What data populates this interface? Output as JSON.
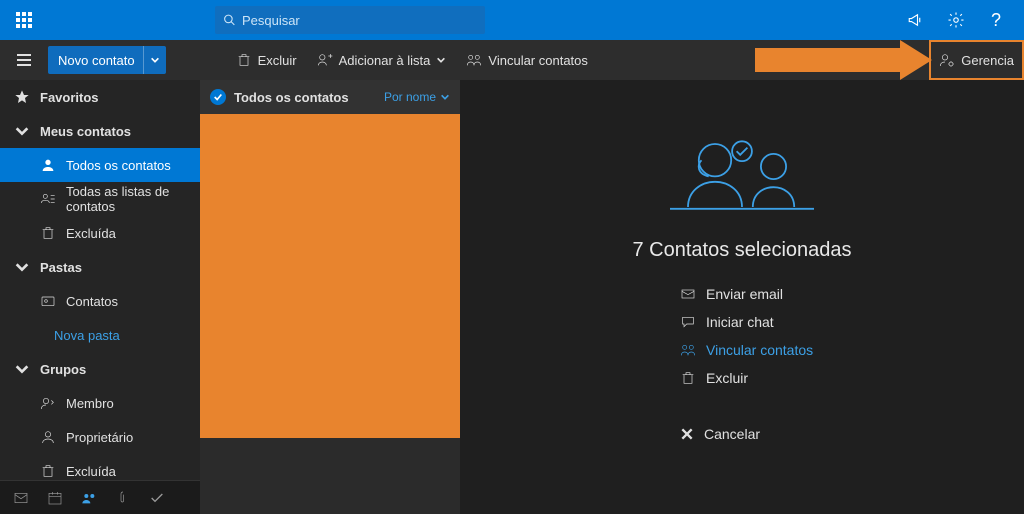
{
  "search": {
    "placeholder": "Pesquisar"
  },
  "toolbar": {
    "new_contact": "Novo contato",
    "delete": "Excluir",
    "add_to_list": "Adicionar à lista",
    "link_contacts": "Vincular contatos",
    "manage": "Gerencia"
  },
  "sidebar": {
    "favorites": "Favoritos",
    "my_contacts": "Meus contatos",
    "all_contacts": "Todos os contatos",
    "all_lists": "Todas as listas de contatos",
    "deleted": "Excluída",
    "folders": "Pastas",
    "contacts_folder": "Contatos",
    "new_folder": "Nova pasta",
    "groups": "Grupos",
    "member": "Membro",
    "owner": "Proprietário",
    "deleted2": "Excluída"
  },
  "list": {
    "title": "Todos os contatos",
    "sort": "Por nome"
  },
  "detail": {
    "selected_title": "7 Contatos selecionadas",
    "send_email": "Enviar email",
    "start_chat": "Iniciar chat",
    "link_contacts": "Vincular contatos",
    "delete": "Excluir",
    "cancel": "Cancelar"
  }
}
